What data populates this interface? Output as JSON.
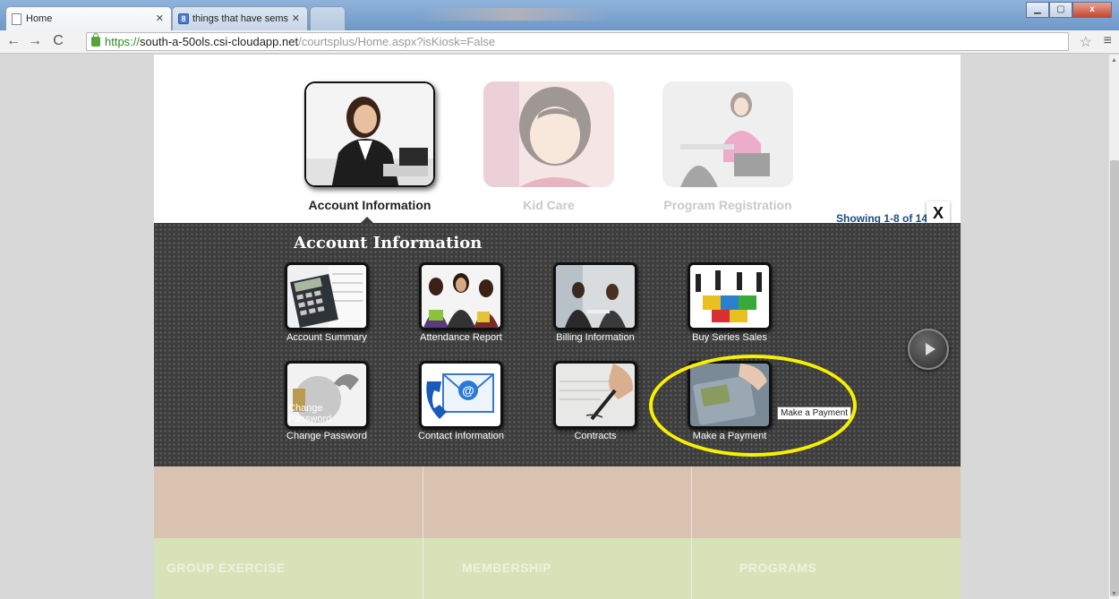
{
  "browser": {
    "tabs": [
      {
        "title": "Home",
        "active": true
      },
      {
        "title": "things that have sems - Go",
        "active": false
      }
    ],
    "url": {
      "scheme": "https://",
      "host": "south-a-50ols.csi-cloudapp.net",
      "path": "/courtsplus/Home.aspx?isKiosk=False"
    },
    "window_controls": {
      "close": "x"
    }
  },
  "categories": [
    {
      "label": "Account Information",
      "state": "active"
    },
    {
      "label": "Kid Care",
      "state": "faded"
    },
    {
      "label": "Program Registration",
      "state": "faded"
    }
  ],
  "panel": {
    "title": "Account Information",
    "showing": "Showing 1-8 of 14",
    "close_label": "X",
    "tiles_row1": [
      {
        "caption": "Account Summary",
        "icon": "calculator-icon"
      },
      {
        "caption": "Attendance Report",
        "icon": "people-icon"
      },
      {
        "caption": "Billing Information",
        "icon": "meeting-icon"
      },
      {
        "caption": "Buy Series Sales",
        "icon": "puzzle-icon"
      }
    ],
    "tiles_row2": [
      {
        "caption": "Change Password",
        "overlay": "Change Password",
        "icon": "padlock-icon"
      },
      {
        "caption": "Contact Information",
        "icon": "email-phone-icon"
      },
      {
        "caption": "Contracts",
        "icon": "pen-signing-icon"
      },
      {
        "caption": "Make a Payment",
        "icon": "card-terminal-icon"
      }
    ],
    "tooltip": "Make a Payment"
  },
  "footer": {
    "links": [
      "GROUP EXERCISE",
      "MEMBERSHIP",
      "PROGRAMS"
    ]
  },
  "colors": {
    "highlight": "#f7f000",
    "showing_text": "#1f4b7a",
    "footer_top": "#d9c2b0",
    "footer_bottom": "#d8e2b8"
  }
}
